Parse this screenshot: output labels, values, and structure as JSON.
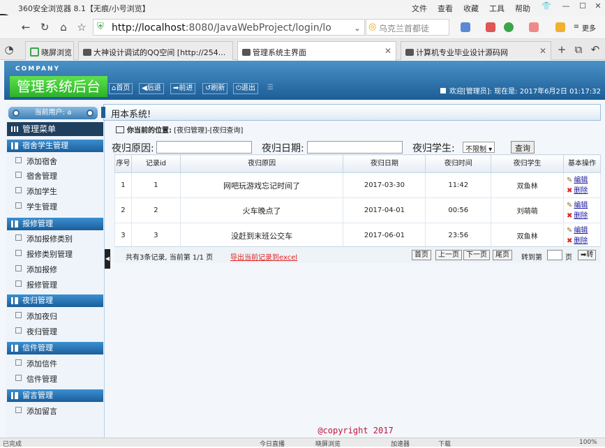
{
  "browser": {
    "title": "360安全浏览器 8.1【无痕/小号浏览】",
    "menu": [
      "文件",
      "查看",
      "收藏",
      "工具",
      "帮助"
    ],
    "url_host": "http://localhost",
    "url_path": ":8080/JavaWebProject/login/lo",
    "search_placeholder": "乌克兰首都徒",
    "more_label": "更多",
    "tabs": [
      {
        "label": "晓屏浏览"
      },
      {
        "label": "大神设计调试的QQ空间 [http://254..."
      },
      {
        "label": "管理系统主界面"
      },
      {
        "label": "计算机专业毕业设计源码网"
      }
    ]
  },
  "app": {
    "company": "COMPANY",
    "title": "管理系统后台",
    "nav": [
      "首页",
      "后退",
      "前进",
      "刷新",
      "退出"
    ],
    "welcome": "欢迎[管理员]:  现在是: 2017年6月2日 01:17:32",
    "notice": "用本系统!",
    "current_user": "当前用户: a"
  },
  "sidebar": {
    "menu_title": "管理菜单",
    "groups": [
      {
        "title": "宿舍学生管理",
        "items": [
          "添加宿舍",
          "宿舍管理",
          "添加学生",
          "学生管理"
        ]
      },
      {
        "title": "报修管理",
        "items": [
          "添加报修类别",
          "报修类别管理",
          "添加报修",
          "报修管理"
        ]
      },
      {
        "title": "夜归管理",
        "items": [
          "添加夜归",
          "夜归管理"
        ]
      },
      {
        "title": "信件管理",
        "items": [
          "添加信件",
          "信件管理"
        ]
      },
      {
        "title": "留言管理",
        "items": [
          "添加留言"
        ]
      }
    ]
  },
  "main": {
    "location_label": "你当前的位置:",
    "location_path": "[夜归管理]-[夜归查询]",
    "filters": {
      "reason_label": "夜归原因:",
      "date_label": "夜归日期:",
      "student_label": "夜归学生:",
      "student_value": "不限制 ▾",
      "query_label": "查询"
    },
    "columns": [
      "序号",
      "记录id",
      "夜归原因",
      "夜归日期",
      "夜归时间",
      "夜归学生",
      "基本操作"
    ],
    "rows": [
      {
        "seq": "1",
        "id": "1",
        "reason": "网吧玩游戏忘记时间了",
        "date": "2017-03-30",
        "time": "11:42",
        "student": "双鱼林",
        "edit": "编辑",
        "del": "删除"
      },
      {
        "seq": "2",
        "id": "2",
        "reason": "火车晚点了",
        "date": "2017-04-01",
        "time": "00:56",
        "student": "刘萌萌",
        "edit": "编辑",
        "del": "删除"
      },
      {
        "seq": "3",
        "id": "3",
        "reason": "没赶到末班公交车",
        "date": "2017-06-01",
        "time": "23:56",
        "student": "双鱼林",
        "edit": "编辑",
        "del": "删除"
      }
    ],
    "pager": {
      "info": "共有3条记录, 当前第 1/1 页",
      "export": "导出当前记录到excel",
      "first": "首页",
      "prev": "上一页",
      "next": "下一页",
      "last": "尾页",
      "goto": "转到第",
      "page_unit": "页",
      "go": "➡转"
    },
    "footer": "@copyright 2017"
  },
  "statusbar": {
    "left": "已完成",
    "items": [
      "今日直播",
      "晓屏浏览",
      "加速器",
      "下载",
      "100%"
    ]
  }
}
